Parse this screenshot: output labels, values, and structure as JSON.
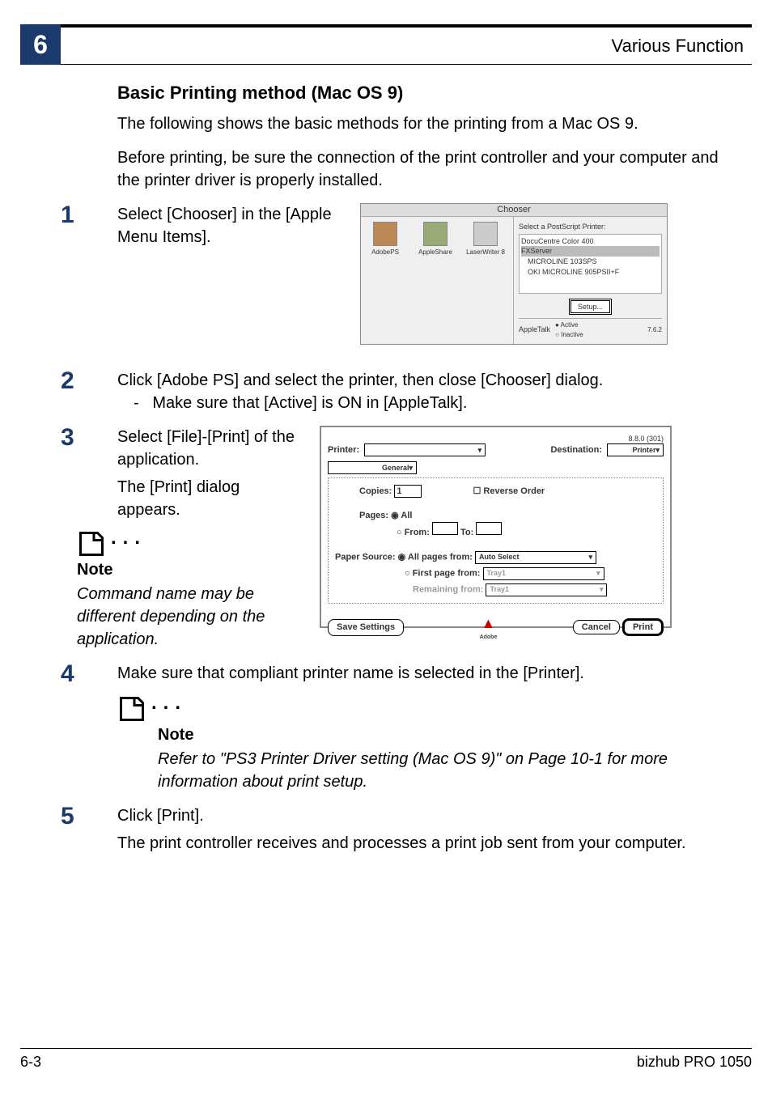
{
  "chapter_number": "6",
  "header": {
    "title": "Various Function"
  },
  "section_heading": "Basic Printing method (Mac OS 9)",
  "intro_1": "The following shows the basic methods for the printing from a Mac OS 9.",
  "intro_2": "Before printing, be sure the connection of the print controller and your computer and the printer driver is properly installed.",
  "step1": {
    "num": "1",
    "text": "Select [Chooser] in the [Apple Menu Items]."
  },
  "step2": {
    "num": "2",
    "text": "Click [Adobe PS] and select the printer, then close [Chooser] dialog.",
    "sub": "Make sure that [Active] is ON in [AppleTalk]."
  },
  "step3": {
    "num": "3",
    "line1": "Select [File]-[Print] of the application.",
    "line2": "The [Print] dialog appears."
  },
  "note1": {
    "label": "Note",
    "text": "Command name may be different depending on the application."
  },
  "step4": {
    "num": "4",
    "text": "Make sure that compliant printer name is selected in the [Printer]."
  },
  "note2": {
    "label": "Note",
    "text": "Refer to \"PS3 Printer Driver setting (Mac OS 9)\" on Page 10-1 for more information about print setup."
  },
  "step5": {
    "num": "5",
    "line1": "Click [Print].",
    "line2": "The print controller receives and processes a print job sent from your computer."
  },
  "chooser": {
    "title": "Chooser",
    "icons": {
      "adobeps": "AdobePS",
      "appleshare": "AppleShare",
      "laserwriter": "LaserWriter 8"
    },
    "select_label": "Select a PostScript Printer:",
    "printers": {
      "p1": "DocuCentre Color 400",
      "p2": "FXServer",
      "p3": "MICROLINE 103SPS",
      "p4": "OKI MICROLINE 905PSII+F"
    },
    "setup_btn": "Setup...",
    "appletalk_label": "AppleTalk",
    "active": "Active",
    "inactive": "Inactive",
    "version": "7.6.2"
  },
  "print_dialog": {
    "version": "8.8.0 (301)",
    "printer_label": "Printer:",
    "destination_label": "Destination:",
    "destination_value": "Printer",
    "tab_label": "General",
    "copies_label": "Copies:",
    "copies_value": "1",
    "reverse_label": "Reverse Order",
    "pages_label": "Pages:",
    "pages_all": "All",
    "pages_from_label": "From:",
    "pages_to_label": "To:",
    "paper_source_label": "Paper Source:",
    "all_pages_from": "All pages from:",
    "auto_select": "Auto Select",
    "first_page_from": "First page from:",
    "tray_value": "Tray1",
    "remaining_from": "Remaining from:",
    "save_settings": "Save Settings",
    "adobe_logo": "Adobe",
    "cancel": "Cancel",
    "print": "Print"
  },
  "footer": {
    "left": "6-3",
    "right": "bizhub PRO 1050"
  }
}
